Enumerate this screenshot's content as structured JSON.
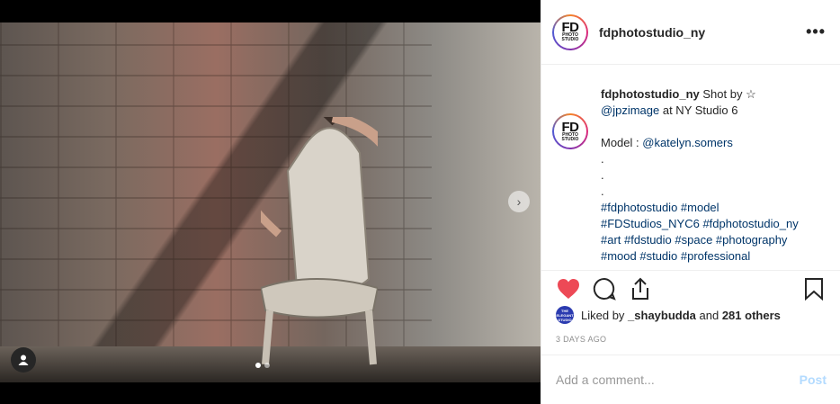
{
  "post": {
    "username": "fdphotostudio_ny",
    "avatar_logo_big": "FD",
    "avatar_logo_small": "PHOTO STUDIO",
    "caption": {
      "line1_user": "fdphotostudio_ny",
      "line1_text": " Shot by ☆",
      "line2_link": "@jpzimage",
      "line2_text": " at NY Studio 6",
      "model_label": "Model : ",
      "model_link": "@katelyn.somers",
      "dot1": ".",
      "dot2": ".",
      "dot3": ".",
      "tags_line1": "#fdphotostudio #model",
      "tags_line2": "#FDStudios_NYC6 #fdphotostudio_ny",
      "tags_line3": "#art #fdstudio #space #photography",
      "tags_line4": "#mood #studio #professional"
    },
    "liker_avatar_text": "THE ELEGANT STUDIO",
    "likes_prefix": "Liked by ",
    "likes_user": "_shaybudda",
    "likes_and": " and ",
    "likes_count": "281 others",
    "date": "3 DAYS AGO",
    "comment_placeholder": "Add a comment...",
    "post_label": "Post"
  },
  "icons": {
    "heart": "heart-icon",
    "comment": "comment-icon",
    "share": "share-icon",
    "save": "bookmark-icon",
    "more": "more-icon",
    "next": "chevron-right-icon",
    "tag_user": "user-tag-icon"
  },
  "colors": {
    "heart": "#ed4956",
    "link": "#003569",
    "post_disabled": "#b3dbff"
  },
  "carousel": {
    "slides": 2,
    "active": 1
  }
}
